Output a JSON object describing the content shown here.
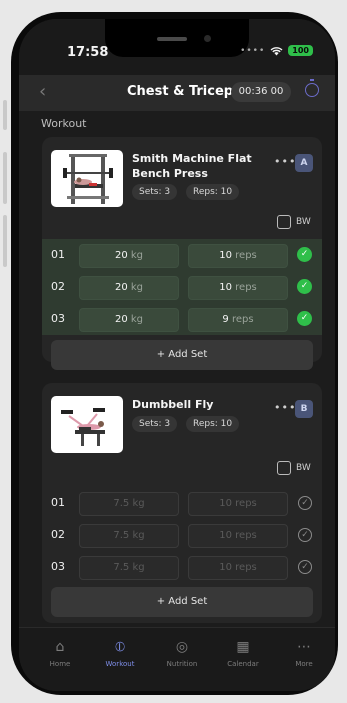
{
  "status": {
    "time": "17:58",
    "battery": "100"
  },
  "header": {
    "title": "Chest & Triceps",
    "timer": "00:36 00"
  },
  "section_label": "Workout",
  "exercises": [
    {
      "name": "Smith Machine Flat Bench Press",
      "sets_label": "Sets: 3",
      "reps_label": "Reps: 10",
      "group": "A",
      "bw_label": "BW",
      "sets": [
        {
          "no": "01",
          "weight": "20",
          "wunit": "kg",
          "reps": "10",
          "runit": "reps",
          "done": true
        },
        {
          "no": "02",
          "weight": "20",
          "wunit": "kg",
          "reps": "10",
          "runit": "reps",
          "done": true
        },
        {
          "no": "03",
          "weight": "20",
          "wunit": "kg",
          "reps": "9",
          "runit": "reps",
          "done": true
        }
      ],
      "add_set": "+ Add Set"
    },
    {
      "name": "Dumbbell Fly",
      "sets_label": "Sets: 3",
      "reps_label": "Reps: 10",
      "group": "B",
      "bw_label": "BW",
      "sets": [
        {
          "no": "01",
          "weight": "7.5",
          "wunit": "kg",
          "reps": "10",
          "runit": "reps",
          "done": false
        },
        {
          "no": "02",
          "weight": "7.5",
          "wunit": "kg",
          "reps": "10",
          "runit": "reps",
          "done": false
        },
        {
          "no": "03",
          "weight": "7.5",
          "wunit": "kg",
          "reps": "10",
          "runit": "reps",
          "done": false
        }
      ],
      "add_set": "+ Add Set"
    }
  ],
  "tabs": [
    {
      "label": "Home",
      "icon": "home-icon",
      "active": false
    },
    {
      "label": "Workout",
      "icon": "dumbbell-icon",
      "active": true
    },
    {
      "label": "Nutrition",
      "icon": "nutrition-icon",
      "active": false
    },
    {
      "label": "Calendar",
      "icon": "calendar-icon",
      "active": false
    },
    {
      "label": "More",
      "icon": "more-icon",
      "active": false
    }
  ],
  "colors": {
    "accent": "#7e8ee8",
    "success": "#2fbf4a",
    "background": "#1c1c1c"
  }
}
